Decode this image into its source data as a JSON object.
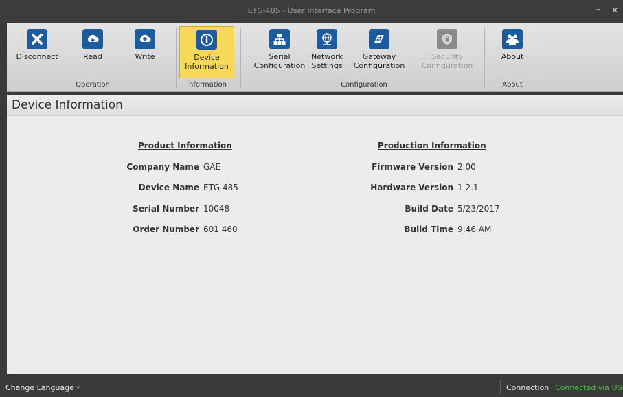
{
  "window": {
    "title": "ETG-485 - User Interface Program",
    "minimize_icon": "minimize-icon",
    "close_icon": "close-icon"
  },
  "ribbon": {
    "buttons": [
      {
        "label": "Disconnect",
        "icon": "x-icon",
        "color": "#1e5b9e"
      },
      {
        "label": "Read",
        "icon": "cloud-download-icon",
        "color": "#1e5b9e"
      },
      {
        "label": "Write",
        "icon": "cloud-upload-icon",
        "color": "#1e5b9e"
      },
      {
        "label": "Device Information",
        "icon": "info-icon",
        "color": "#1e5b9e"
      },
      {
        "label": "Serial Configuration",
        "icon": "network-tree-icon",
        "color": "#1e5b9e"
      },
      {
        "label": "Network Settings",
        "icon": "globe-network-icon",
        "color": "#1e5b9e"
      },
      {
        "label": "Gateway Configuration",
        "icon": "gateway-swap-icon",
        "color": "#1e5b9e"
      },
      {
        "label": "Security Configuration",
        "icon": "shield-lock-icon",
        "color": "#8a8a8a"
      },
      {
        "label": "About",
        "icon": "users-icon",
        "color": "#1e5b9e"
      }
    ],
    "groups": [
      "Operation",
      "Information",
      "Configuration",
      "About"
    ]
  },
  "page": {
    "title": "Device Information"
  },
  "product": {
    "heading": "Product Information",
    "fields": [
      {
        "label": "Company Name",
        "value": "GAE"
      },
      {
        "label": "Device Name",
        "value": "ETG 485"
      },
      {
        "label": "Serial Number",
        "value": "10048"
      },
      {
        "label": "Order Number",
        "value": "601 460"
      }
    ]
  },
  "production": {
    "heading": "Production Information",
    "fields": [
      {
        "label": "Firmware Version",
        "value": "2.00"
      },
      {
        "label": "Hardware Version",
        "value": "1.2.1"
      },
      {
        "label": "Build Date",
        "value": "5/23/2017"
      },
      {
        "label": "Build Time",
        "value": "9:46 AM"
      }
    ]
  },
  "status": {
    "language": "Change Language",
    "connection_label": "Connection",
    "connection_value": "Connected via USB",
    "connection_color": "#44c23a"
  },
  "colors": {
    "active_button": "#f7d85a",
    "icon_blue": "#1e5b9e"
  }
}
